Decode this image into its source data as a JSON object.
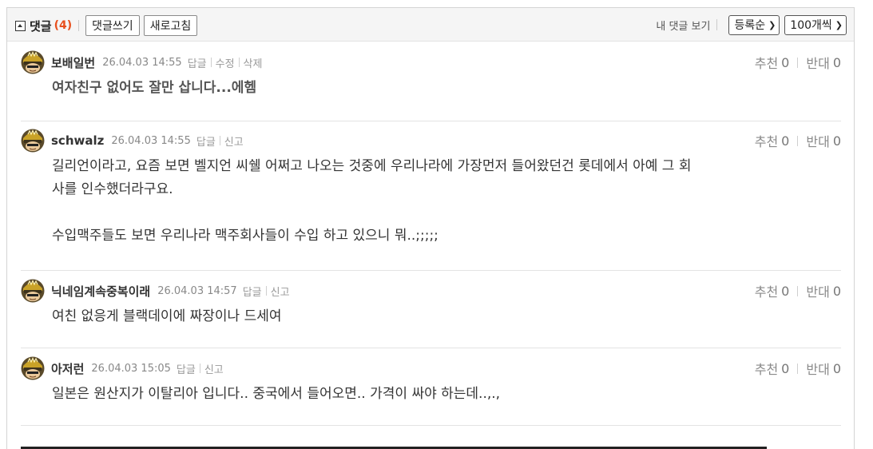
{
  "header": {
    "title": "댓글",
    "count": "(4)",
    "write_label": "댓글쓰기",
    "refresh_label": "새로고침",
    "view_mine_label": "내 댓글 보기",
    "sort_select": "등록순",
    "per_page_select": "100개씩"
  },
  "comments": [
    {
      "nick": "보배일번",
      "date": "26.04.03 14:55",
      "actions": [
        "답글",
        "수정",
        "삭제"
      ],
      "body": "여자친구 없어도 잘만 삽니다...에헴",
      "recommend_label": "추천",
      "recommend": "0",
      "oppose_label": "반대",
      "oppose": "0"
    },
    {
      "nick": "schwalz",
      "date": "26.04.03 14:55",
      "actions": [
        "답글",
        "신고"
      ],
      "body": "길리언이라고, 요즘 보면 벨지언 씨쉘 어쩌고 나오는 것중에 우리나라에 가장먼저 들어왔던건 롯데에서 아예 그 회\n사를 인수했더라구요.\n\n수입맥주들도 보면 우리나라 맥주회사들이 수입 하고 있으니 뭐..;;;;;",
      "recommend_label": "추천",
      "recommend": "0",
      "oppose_label": "반대",
      "oppose": "0"
    },
    {
      "nick": "닉네임계속중복이래",
      "date": "26.04.03 14:57",
      "actions": [
        "답글",
        "신고"
      ],
      "body": "여친 없응게 블랙데이에 짜장이나 드세여",
      "recommend_label": "추천",
      "recommend": "0",
      "oppose_label": "반대",
      "oppose": "0"
    },
    {
      "nick": "아저런",
      "date": "26.04.03 15:05",
      "actions": [
        "답글",
        "신고"
      ],
      "body": "일본은 원산지가 이탈리아 입니다.. 중국에서 들어오면.. 가격이 싸야 하는데..,.,",
      "recommend_label": "추천",
      "recommend": "0",
      "oppose_label": "반대",
      "oppose": "0"
    }
  ],
  "colors": {
    "count": "#e8501e",
    "header_bg": "#f5f5f5",
    "border": "#e3e3e3"
  }
}
